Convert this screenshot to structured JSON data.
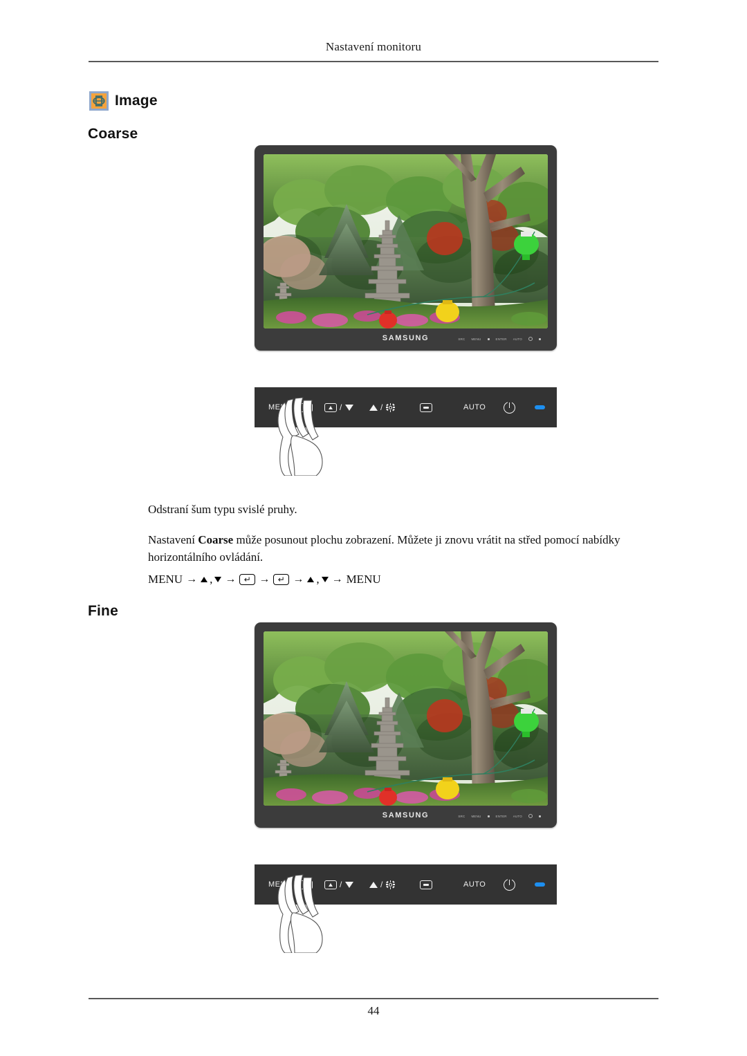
{
  "document": {
    "header_title": "Nastavení monitoru",
    "page_number": "44"
  },
  "section": {
    "icon": "image-adjust-icon",
    "title": "Image"
  },
  "coarse": {
    "heading": "Coarse",
    "description_1": "Odstraní šum typu svislé pruhy.",
    "description_2_prefix": "Nastavení ",
    "description_2_bold": "Coarse",
    "description_2_suffix": " může posunout plochu zobrazení. Můžete ji znovu vrátit na střed pomocí nabídky horizontálního ovládání.",
    "menu_path": {
      "start": "MENU",
      "arrow": "→",
      "comma": ",",
      "enter_glyph": "↵",
      "end": "MENU"
    }
  },
  "fine": {
    "heading": "Fine"
  },
  "monitor": {
    "brand": "SAMSUNG",
    "bezel_keys": [
      "AUTO",
      "AUTO",
      "▲",
      "MENU",
      "SRC"
    ],
    "screen_alt": "garden-scene-with-stone-pagoda"
  },
  "control_bar": {
    "buttons": [
      {
        "name": "menu-button",
        "label": "MENU",
        "glyph": "menu-icon"
      },
      {
        "name": "source-down-button",
        "label": "",
        "glyph": "source-slash-down"
      },
      {
        "name": "up-brightness-button",
        "label": "",
        "glyph": "up-slash-brightness"
      },
      {
        "name": "enter-button",
        "label": "",
        "glyph": "enter-key"
      },
      {
        "name": "auto-button",
        "label": "AUTO",
        "glyph": ""
      },
      {
        "name": "power-button",
        "label": "",
        "glyph": "power-icon"
      },
      {
        "name": "power-led",
        "label": "",
        "glyph": "led-indicator"
      }
    ],
    "auto_label": "AUTO",
    "menu_label": "MENU",
    "led_color": "#1d8ff0",
    "bar_color": "#333333"
  },
  "colors": {
    "icon_background": "#f5a33c",
    "icon_border": "#8fa8cc",
    "monitor_bezel": "#3c3c3c",
    "rule": "#585858"
  }
}
